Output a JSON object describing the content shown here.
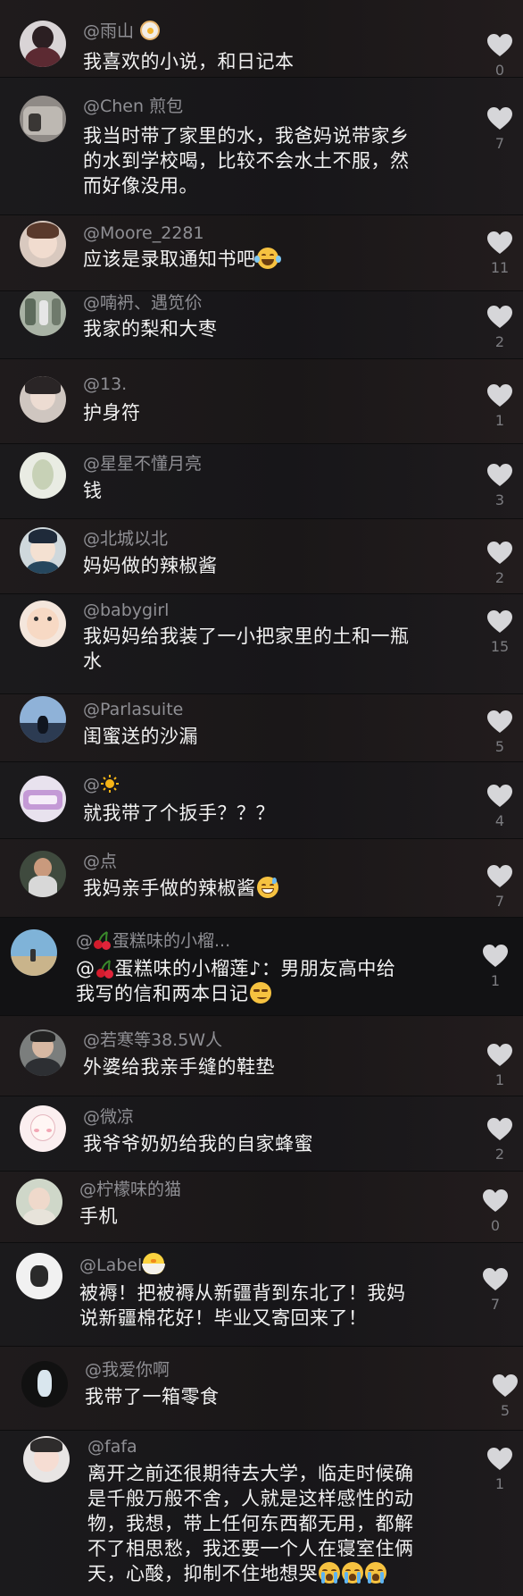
{
  "colors": {
    "background": "#151517",
    "username": "#8f8f94",
    "text": "#f2f2f2",
    "like_icon": "#d6d6d9",
    "count": "#7c7c80"
  },
  "icons": {
    "like": "heart-icon",
    "cherry": "cherry-emoji",
    "sun": "sun-emoji",
    "laugh_cry": "face-with-tears-of-joy-emoji",
    "sweat_smile": "grinning-face-with-sweat-emoji",
    "smirk": "smirking-face-emoji",
    "crying": "loudly-crying-face-emoji",
    "chick": "hatching-chick-emoji",
    "fried_egg": "fried-egg-emoji"
  },
  "comments": [
    {
      "username": "@雨山",
      "text1": "我喜欢的小说，和日记本",
      "likes": "0"
    },
    {
      "username": "@Chen 煎包",
      "text1": "我当时带了家里的水，我爸妈说带家乡",
      "text2": "的水到学校喝，比较不会水土不服，然",
      "text3": "而好像没用。",
      "likes": "7"
    },
    {
      "username": "@Moore_2281",
      "text1": "应该是录取通知书吧",
      "likes": "11"
    },
    {
      "username": "@喃袇、遇笕伱",
      "text1": "我家的梨和大枣",
      "likes": "2"
    },
    {
      "username": "@13.",
      "text1": "护身符",
      "likes": "1"
    },
    {
      "username": "@星星不懂月亮",
      "text1": "钱",
      "likes": "3"
    },
    {
      "username": "@北城以北",
      "text1": "妈妈做的辣椒酱",
      "likes": "2"
    },
    {
      "username": "@babygirl",
      "text1": "我妈妈给我装了一小把家里的土和一瓶",
      "text2": "水",
      "likes": "15"
    },
    {
      "username": "@Parlasuite",
      "text1": "闺蜜送的沙漏",
      "likes": "5"
    },
    {
      "username": "@",
      "text1": "就我带了个扳手？？？",
      "likes": "4"
    },
    {
      "username": "@点",
      "text1": "我妈亲手做的辣椒酱",
      "likes": "7"
    },
    {
      "username_prefix": "@",
      "username": "蛋糕味的小榴...",
      "text_prefix": "@",
      "text1": "蛋糕味的小榴莲♪：男朋友高中给",
      "text2": "我写的信和两本日记",
      "likes": "1"
    },
    {
      "username": "@若寒等38.5W人",
      "text1": "外婆给我亲手缝的鞋垫",
      "likes": "1"
    },
    {
      "username": "@微凉",
      "text1": "我爷爷奶奶给我的自家蜂蜜",
      "likes": "2"
    },
    {
      "username": "@柠檬味的猫",
      "text1": "手机",
      "likes": "0"
    },
    {
      "username": "@Label",
      "text1": "被褥！把被褥从新疆背到东北了！我妈",
      "text2": "说新疆棉花好！毕业又寄回来了！",
      "likes": "7"
    },
    {
      "username": "@我爱你啊",
      "text1": "我带了一箱零食",
      "likes": "5"
    },
    {
      "username": "@fafa",
      "text1": "离开之前还很期待去大学，临走时候确",
      "text2": "是千般万般不舍，人就是这样感性的动",
      "text3": "物，我想，带上任何东西都无用，都解",
      "text4": "不了相思愁，我还要一个人在寝室住俩",
      "text5": "天，心酸，抑制不住地想哭",
      "likes": "1"
    }
  ]
}
